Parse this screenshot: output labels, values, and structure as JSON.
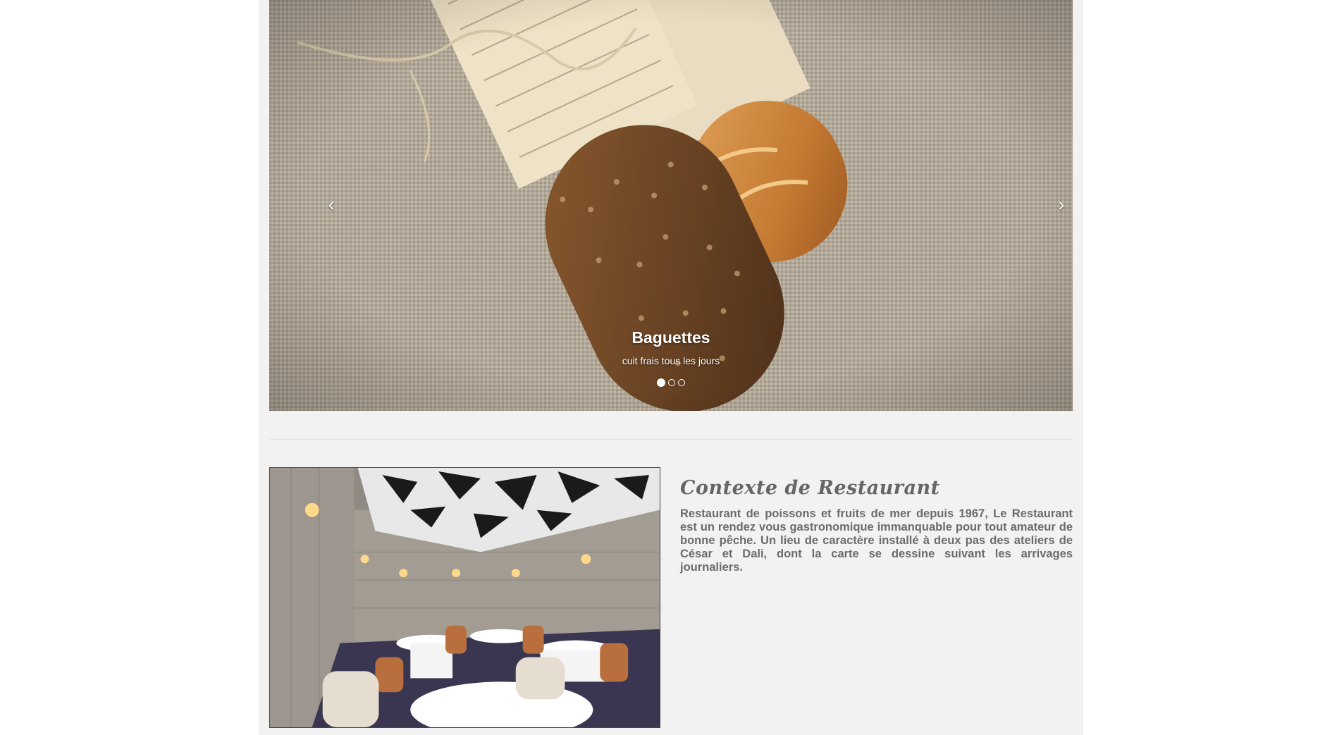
{
  "carousel": {
    "slide_title": "Baguettes",
    "slide_subtitle": "cuit frais tous les jours",
    "prev_label": "‹",
    "next_label": "›",
    "indicator_count": 3,
    "active_indicator": 1
  },
  "context": {
    "heading": "Contexte de Restaurant",
    "body": "Restaurant de poissons et fruits de mer depuis 1967, Le Restaurant est un rendez vous gastronomique immanquable pour tout amateur de bonne pêche. Un lieu de caractère installé à deux pas des ateliers de César et Dali, dont la carte se dessine suivant les arrivages journaliers."
  },
  "colors": {
    "page_background": "#f2f2f2",
    "heading_text": "#666666",
    "body_text": "#6b6b6b",
    "caption_text": "#ffffff"
  }
}
